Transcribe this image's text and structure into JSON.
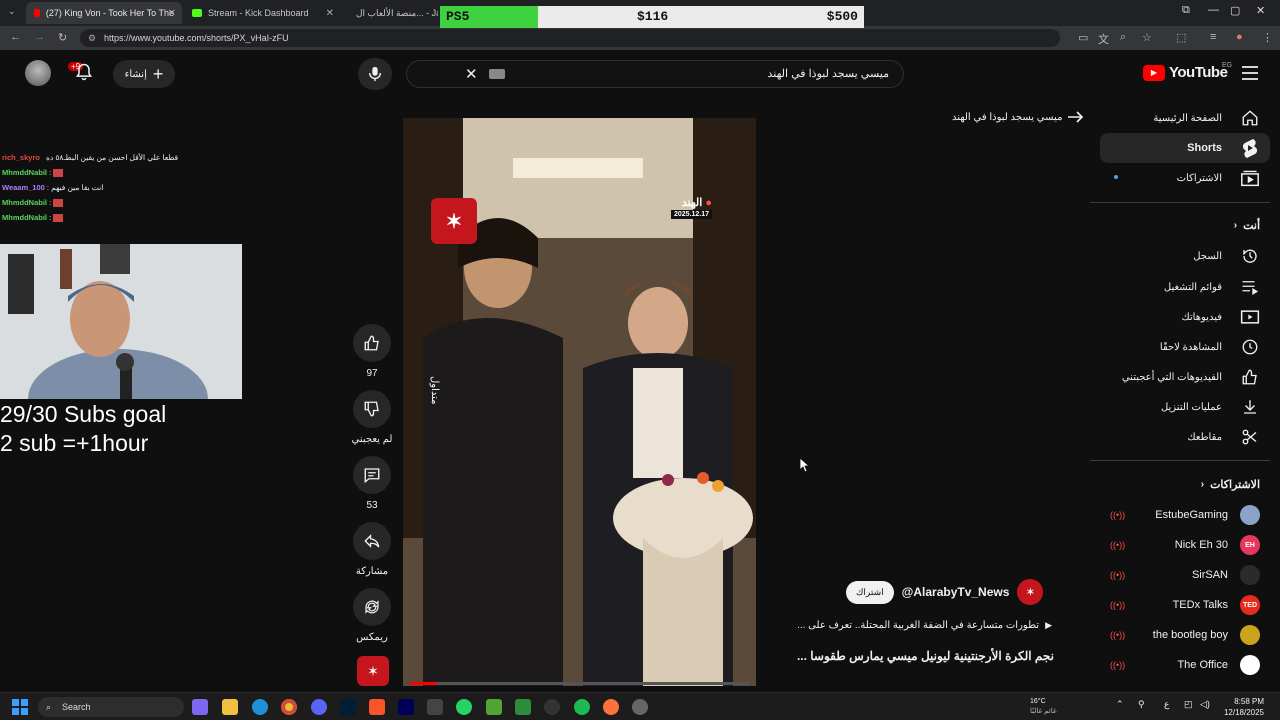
{
  "browser": {
    "tabs": [
      {
        "title": "(27) King Von - Took Her To The",
        "icon_color": "#ff0000",
        "active": true
      },
      {
        "title": "Stream - Kick Dashboard",
        "icon_color": "#53fc18",
        "active": false
      },
      {
        "title": "منصة الألعاب ال... - Ja",
        "icon_color": "#888888",
        "active": false
      }
    ],
    "url": "https://www.youtube.com/shorts/PX_vHaI-zFU"
  },
  "overlay_goal": {
    "name": "PS5",
    "current": "$116",
    "target": "$500",
    "progress": 0.232,
    "fill_color": "#3fd13f"
  },
  "stream_overlay": {
    "chat": [
      {
        "user": "rich_skyro",
        "color": "#e04848",
        "message": "قطعا علي الأقل احسن من يقين البطـ٥٨ ده"
      },
      {
        "user": "MhmddNabil",
        "color": "#5bd35b",
        "message": ""
      },
      {
        "user": "Weaam_100",
        "color": "#b77aff",
        "message": "انت بقا مين فيهم"
      },
      {
        "user": "MhmddNabil",
        "color": "#5bd35b",
        "message": ""
      },
      {
        "user": "MhmddNabil",
        "color": "#5bd35b",
        "message": ""
      }
    ],
    "subs_goal_line1": "29/30 Subs goal",
    "subs_goal_line2": "2 sub =+1hour"
  },
  "header": {
    "search_value": "ميسي يسجد لبوذا في الهند",
    "create_label": "إنشاء",
    "notif_count": "+9",
    "logo_text": "YouTube",
    "region": "EG"
  },
  "shorts": {
    "suggestion": "ميسي يسجد لبوذا في الهند",
    "video_overlay": {
      "location": "الهند",
      "date": "2025.12.17",
      "trend_tag": "متداول"
    },
    "actions": {
      "likes": "97",
      "dislike_label": "لم يعجبني",
      "comments": "53",
      "share_label": "مشاركة",
      "remix_label": "ريمكس"
    },
    "channel": "@AlarabyTv_News",
    "subscribe_label": "اشتراك",
    "description": "تطورات متسارعة في الضفة الغربية المحتلة.. تعرف على ...",
    "title": "نجم الكرة الأرجنتينية ليونيل ميسي يمارس طقوسا ...",
    "progress": 0.08
  },
  "sidebar": {
    "main": [
      {
        "label": "الصفحة الرئيسية",
        "icon": "home-icon"
      },
      {
        "label": "Shorts",
        "icon": "shorts-icon"
      },
      {
        "label": "الاشتراكات",
        "icon": "subscriptions-icon"
      }
    ],
    "you_header": "أنت",
    "you": [
      {
        "label": "السجل",
        "icon": "history-icon"
      },
      {
        "label": "قوائم التشغيل",
        "icon": "playlists-icon"
      },
      {
        "label": "فيديوهاتك",
        "icon": "your-videos-icon"
      },
      {
        "label": "المشاهدة لاحقًا",
        "icon": "watch-later-icon"
      },
      {
        "label": "الفيديوهات التي أعجبتني",
        "icon": "liked-icon"
      },
      {
        "label": "عمليات التنزيل",
        "icon": "download-icon"
      },
      {
        "label": "مقاطعك",
        "icon": "clips-icon"
      }
    ],
    "subs_header": "الاشتراكات",
    "subscriptions": [
      {
        "name": "EstubeGaming",
        "color": "#8aa4c8",
        "initials": ""
      },
      {
        "name": "Nick Eh 30",
        "color": "#e8365d",
        "initials": "EH"
      },
      {
        "name": "SirSAN",
        "color": "#2b2b2b",
        "initials": ""
      },
      {
        "name": "TEDx Talks",
        "color": "#e62b1e",
        "initials": "TED"
      },
      {
        "name": "the bootleg boy",
        "color": "#c9a41c",
        "initials": ""
      },
      {
        "name": "The Office",
        "color": "#ffffff",
        "initials": ""
      }
    ]
  },
  "taskbar": {
    "search_placeholder": "Search",
    "weather_temp": "16°C",
    "weather_desc": "غائم غالبًا",
    "time": "8:58 PM",
    "date": "12/18/2025"
  }
}
